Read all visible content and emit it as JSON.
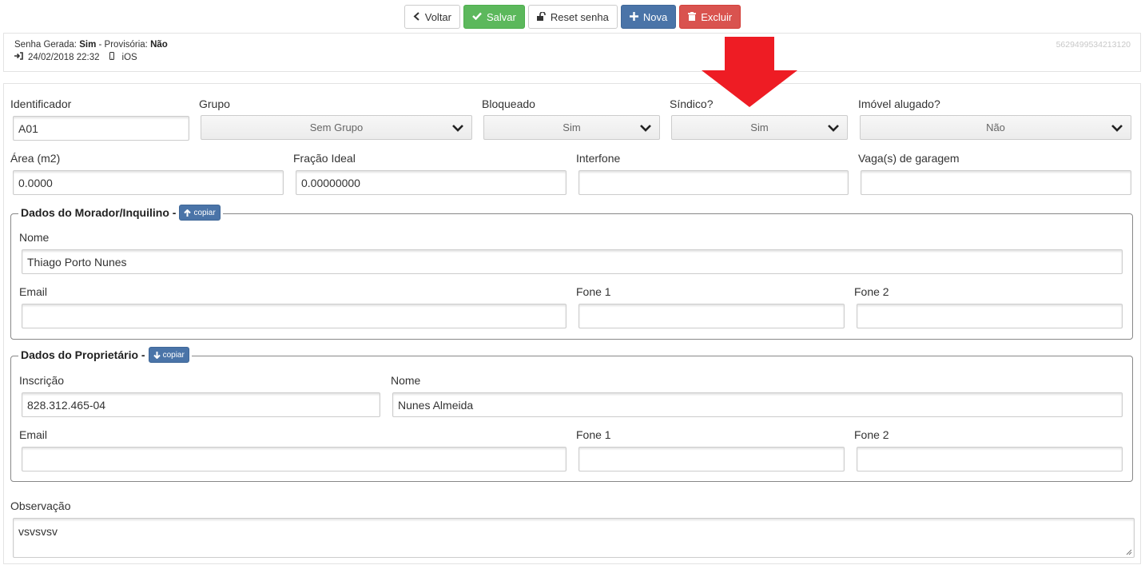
{
  "toolbar": {
    "back_label": "Voltar",
    "save_label": "Salvar",
    "reset_label": "Reset senha",
    "new_label": "Nova",
    "delete_label": "Excluir"
  },
  "info": {
    "senha_label": "Senha Gerada:",
    "senha_value": "Sim",
    "sep": " - ",
    "provisoria_label": "Provisória:",
    "provisoria_value": "Não",
    "login_date": "24/02/2018 22:32",
    "device": "iOS",
    "code": "5629499534213120"
  },
  "form": {
    "identificador": {
      "label": "Identificador",
      "value": "A01"
    },
    "grupo": {
      "label": "Grupo",
      "value": "Sem Grupo"
    },
    "bloqueado": {
      "label": "Bloqueado",
      "value": "Sim"
    },
    "sindico": {
      "label": "Síndico?",
      "value": "Sim"
    },
    "alugado": {
      "label": "Imóvel alugado?",
      "value": "Não"
    },
    "area": {
      "label": "Área (m2)",
      "value": "0.0000"
    },
    "fracao": {
      "label": "Fração Ideal",
      "value": "0.00000000"
    },
    "interfone": {
      "label": "Interfone",
      "value": ""
    },
    "vagas": {
      "label": "Vaga(s) de garagem",
      "value": ""
    }
  },
  "morador": {
    "legend": "Dados do Morador/Inquilino -",
    "copy_label": "copiar",
    "nome_label": "Nome",
    "nome_value": "Thiago Porto Nunes",
    "email_label": "Email",
    "email_value": "",
    "fone1_label": "Fone 1",
    "fone1_value": "",
    "fone2_label": "Fone 2",
    "fone2_value": ""
  },
  "proprietario": {
    "legend": "Dados do Proprietário -",
    "copy_label": "copiar",
    "inscricao_label": "Inscrição",
    "inscricao_value": "828.312.465-04",
    "nome_label": "Nome",
    "nome_value": "Nunes Almeida",
    "email_label": "Email",
    "email_value": "",
    "fone1_label": "Fone 1",
    "fone1_value": "",
    "fone2_label": "Fone 2",
    "fone2_value": ""
  },
  "observacao": {
    "label": "Observação",
    "value": "vsvsvsv"
  },
  "icons": {
    "back": "chevron-left-icon",
    "save": "check-icon",
    "reset": "unlock-icon",
    "new": "plus-icon",
    "delete": "trash-icon",
    "login": "sign-in-icon",
    "device": "mobile-icon",
    "annotation": "red-down-arrow"
  },
  "colors": {
    "green": "#5cb85c",
    "blue": "#4a74a8",
    "red": "#d9534f",
    "arrow": "#ee1c24"
  }
}
